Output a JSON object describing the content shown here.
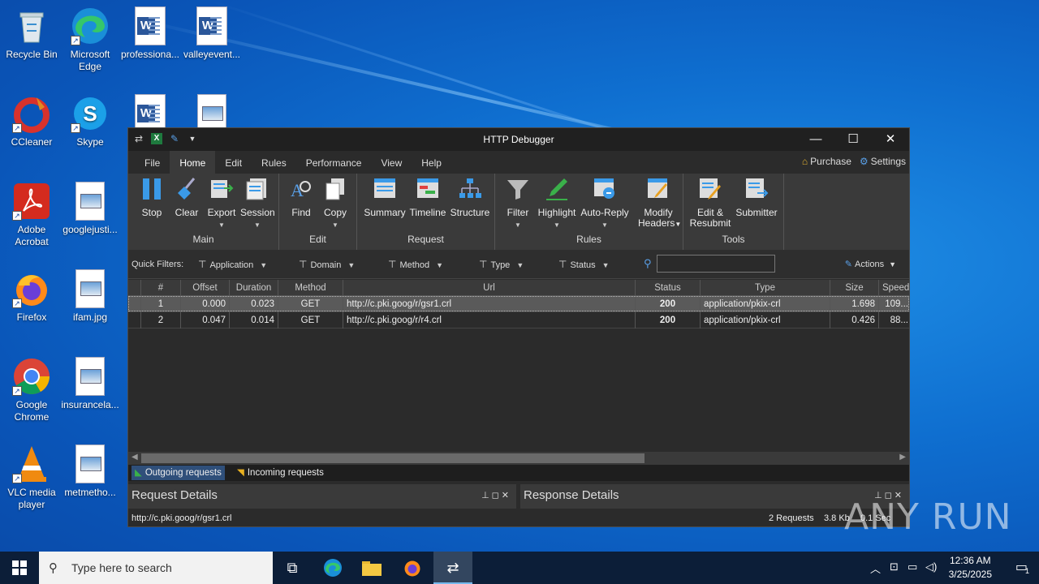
{
  "desktop": {
    "icons": [
      {
        "label": "Recycle Bin",
        "icon": "recycle-bin-icon"
      },
      {
        "label": "Microsoft Edge",
        "icon": "edge-icon"
      },
      {
        "label": "professiona...",
        "icon": "word-doc-icon"
      },
      {
        "label": "valleyevent...",
        "icon": "word-doc-icon"
      },
      {
        "label": "CCleaner",
        "icon": "ccleaner-icon"
      },
      {
        "label": "Skype",
        "icon": "skype-icon"
      },
      {
        "label": "Adobe Acrobat",
        "icon": "acrobat-icon"
      },
      {
        "label": "googlejusti...",
        "icon": "image-file-icon"
      },
      {
        "label": "Firefox",
        "icon": "firefox-icon"
      },
      {
        "label": "ifam.jpg",
        "icon": "image-file-icon"
      },
      {
        "label": "Google Chrome",
        "icon": "chrome-icon"
      },
      {
        "label": "insurancela...",
        "icon": "image-file-icon"
      },
      {
        "label": "VLC media player",
        "icon": "vlc-icon"
      },
      {
        "label": "metmetho...",
        "icon": "image-file-icon"
      }
    ]
  },
  "window": {
    "title": "HTTP Debugger",
    "menu": [
      "File",
      "Home",
      "Edit",
      "Rules",
      "Performance",
      "View",
      "Help"
    ],
    "active_menu": "Home",
    "purchase": "Purchase",
    "settings": "Settings"
  },
  "ribbon": {
    "groups": {
      "main": "Main",
      "edit": "Edit",
      "request": "Request",
      "rules": "Rules",
      "tools": "Tools"
    },
    "buttons": {
      "stop": "Stop",
      "clear": "Clear",
      "export": "Export",
      "session": "Session",
      "find": "Find",
      "copy": "Copy",
      "summary": "Summary",
      "timeline": "Timeline",
      "structure": "Structure",
      "filter": "Filter",
      "highlight": "Highlight",
      "auto_reply": "Auto-Reply",
      "modify_headers_1": "Modify",
      "modify_headers_2": "Headers",
      "edit_resubmit_1": "Edit &",
      "edit_resubmit_2": "Resubmit",
      "submitter": "Submitter"
    }
  },
  "quick_filters": {
    "label": "Quick Filters:",
    "items": [
      "Application",
      "Domain",
      "Method",
      "Type",
      "Status"
    ],
    "search_value": "",
    "actions": "Actions"
  },
  "grid": {
    "columns": [
      "#",
      "Offset",
      "Duration",
      "Method",
      "Url",
      "Status",
      "Type",
      "Size",
      "Speed"
    ],
    "rows": [
      {
        "num": "1",
        "offset": "0.000",
        "duration": "0.023",
        "method": "GET",
        "url": "http://c.pki.goog/r/gsr1.crl",
        "status": "200",
        "type": "application/pkix-crl",
        "size": "1.698",
        "speed": "109..."
      },
      {
        "num": "2",
        "offset": "0.047",
        "duration": "0.014",
        "method": "GET",
        "url": "http://c.pki.goog/r/r4.crl",
        "status": "200",
        "type": "application/pkix-crl",
        "size": "0.426",
        "speed": "88..."
      }
    ]
  },
  "bottom_tabs": {
    "outgoing": "Outgoing requests",
    "incoming": "Incoming requests"
  },
  "panes": {
    "request": "Request Details",
    "response": "Response Details"
  },
  "status": {
    "url": "http://c.pki.goog/r/gsr1.crl",
    "requests": "2 Requests",
    "size": "3.8 Kb",
    "time": "0.1 Sec"
  },
  "watermark": "ANY RUN",
  "taskbar": {
    "search_placeholder": "Type here to search",
    "time": "12:36 AM",
    "date": "3/25/2025",
    "notification_count": "1"
  }
}
